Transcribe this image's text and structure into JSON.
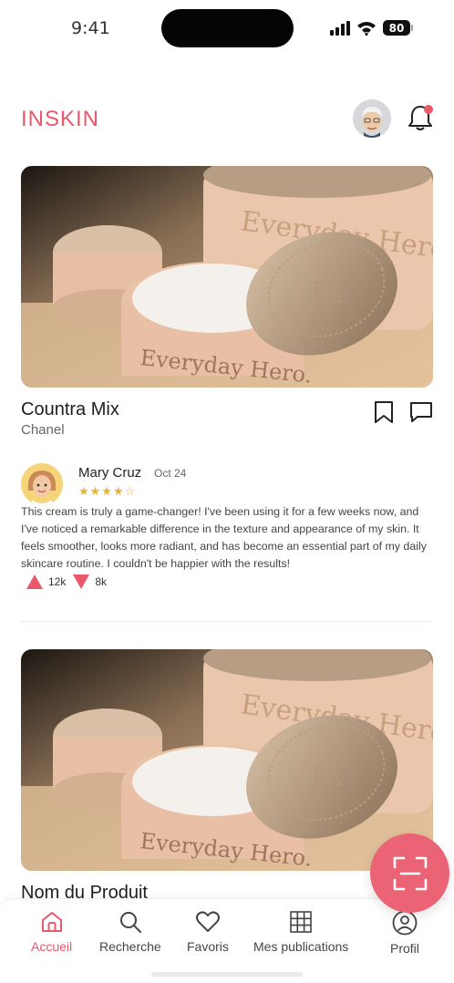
{
  "status_bar": {
    "time": "9:41",
    "battery": "80"
  },
  "header": {
    "logo": "INSKIN"
  },
  "posts": [
    {
      "product_name": "Countra Mix",
      "brand": "Chanel",
      "image_jar_text": "Everyday Hero.",
      "image_lid_text": "IA",
      "review": {
        "author": "Mary Cruz",
        "date": "Oct 24",
        "stars": "★★★★☆",
        "rating": 4,
        "text": "This cream is truly a game-changer! I've been using it for a few weeks now, and I've noticed a remarkable difference in the texture and appearance of my skin. It feels smoother, looks more radiant, and has become an essential part of my daily skincare routine. I couldn't be happier with the results!",
        "upvotes": "12k",
        "downvotes": "8k"
      }
    },
    {
      "product_name": "Nom du Produit",
      "image_jar_text": "Everyday Hero.",
      "image_lid_text": "IA"
    }
  ],
  "bottom_nav": {
    "items": [
      {
        "label": "Accueil",
        "icon": "home-icon",
        "active": true
      },
      {
        "label": "Recherche",
        "icon": "search-icon"
      },
      {
        "label": "Favoris",
        "icon": "heart-icon"
      },
      {
        "label": "Mes publications",
        "icon": "grid-icon"
      },
      {
        "label": "Profil",
        "icon": "user-icon"
      }
    ]
  },
  "colors": {
    "accent": "#e9586b",
    "star": "#e9b23c"
  }
}
